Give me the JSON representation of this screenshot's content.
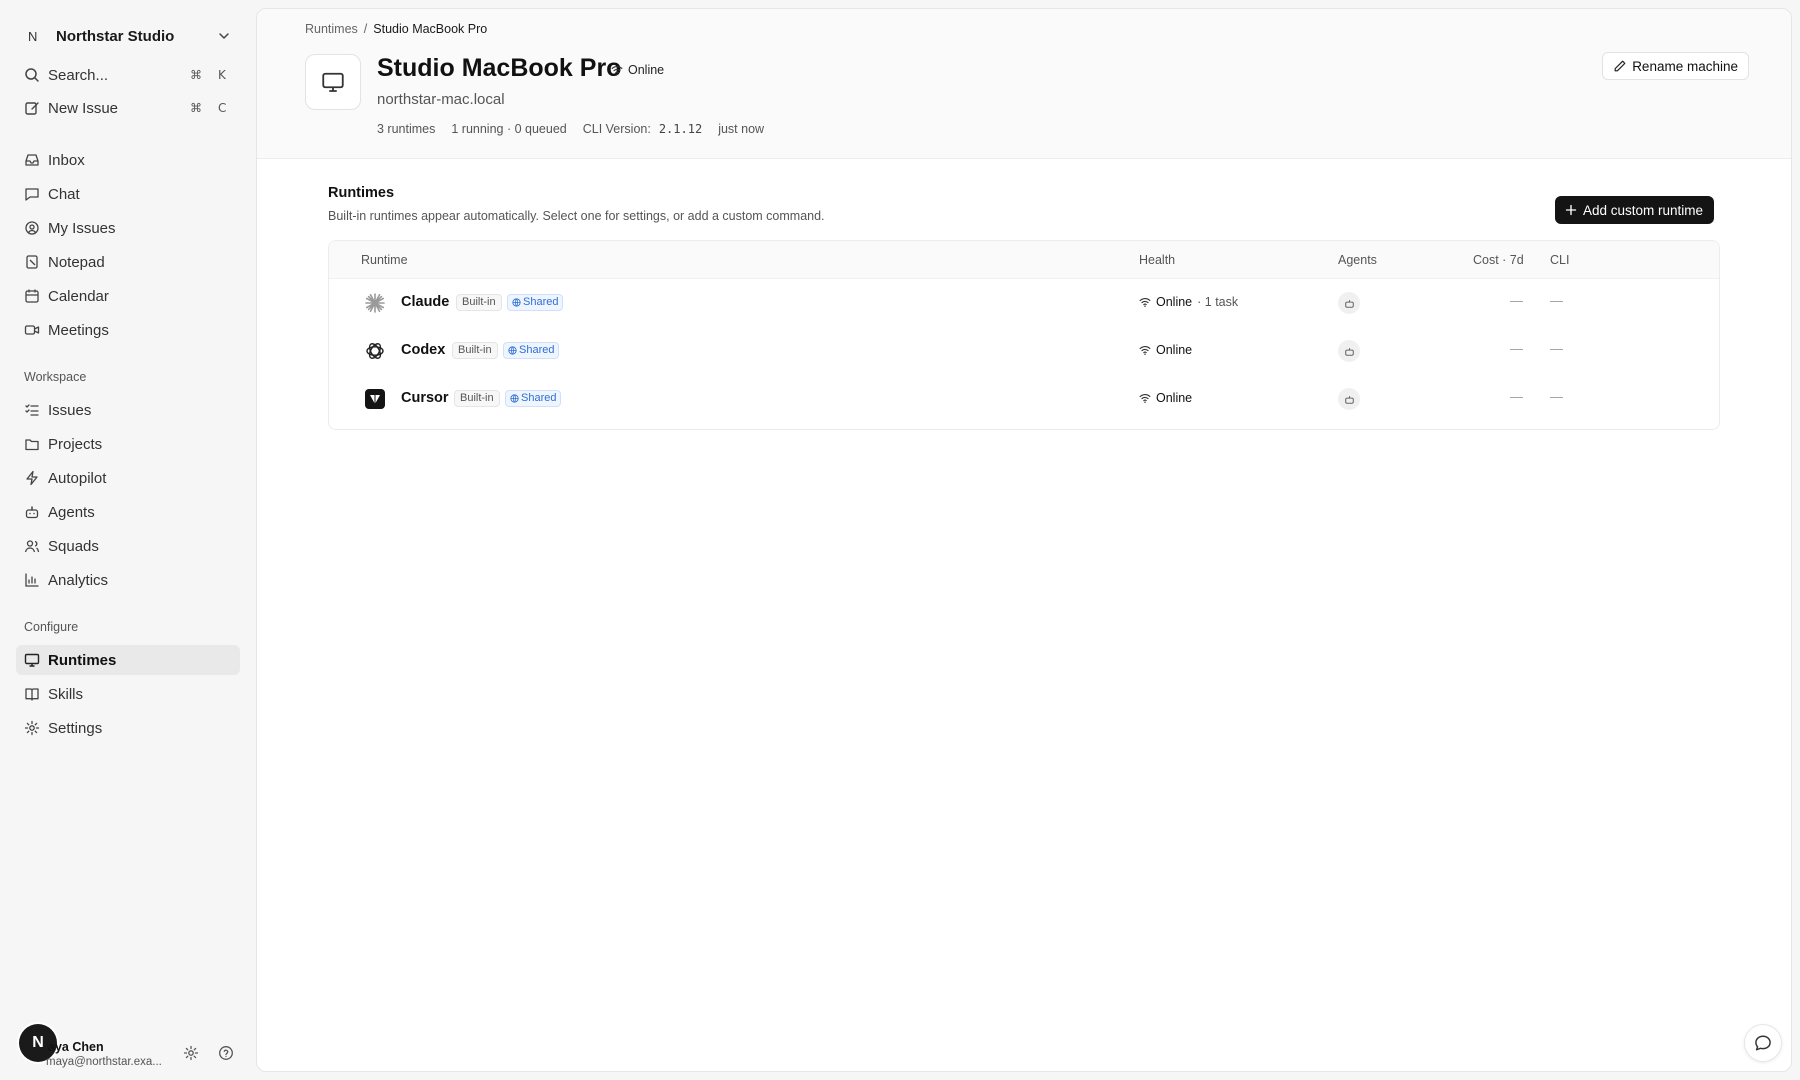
{
  "sidebar": {
    "workspace": {
      "logo_letter": "N",
      "name": "Northstar Studio"
    },
    "search": {
      "label": "Search...",
      "shortcut_mod": "⌘",
      "shortcut_key": "K"
    },
    "new_issue": {
      "label": "New Issue",
      "shortcut_mod": "⌘",
      "shortcut_key": "C"
    },
    "primary": [
      {
        "label": "Inbox",
        "icon": "inbox-icon"
      },
      {
        "label": "Chat",
        "icon": "chat-icon"
      },
      {
        "label": "My Issues",
        "icon": "user-circle-icon"
      },
      {
        "label": "Notepad",
        "icon": "notepad-icon"
      },
      {
        "label": "Calendar",
        "icon": "calendar-icon"
      },
      {
        "label": "Meetings",
        "icon": "video-icon"
      }
    ],
    "workspace_section": {
      "label": "Workspace",
      "items": [
        {
          "label": "Issues",
          "icon": "list-icon"
        },
        {
          "label": "Projects",
          "icon": "folder-icon"
        },
        {
          "label": "Autopilot",
          "icon": "bolt-icon"
        },
        {
          "label": "Agents",
          "icon": "robot-icon"
        },
        {
          "label": "Squads",
          "icon": "users-icon"
        },
        {
          "label": "Analytics",
          "icon": "bar-chart-icon"
        }
      ]
    },
    "configure_section": {
      "label": "Configure",
      "items": [
        {
          "label": "Runtimes",
          "icon": "monitor-icon",
          "active": true
        },
        {
          "label": "Skills",
          "icon": "book-icon"
        },
        {
          "label": "Settings",
          "icon": "gear-icon"
        }
      ]
    },
    "user": {
      "avatar_letter": "N",
      "name": "aya Chen",
      "email": "maya@northstar.exa..."
    }
  },
  "header": {
    "breadcrumb": {
      "parent": "Runtimes",
      "separator": "/",
      "current": "Studio MacBook Pro"
    },
    "title": "Studio MacBook Pro",
    "status": "Online",
    "hostname": "northstar-mac.local",
    "meta": {
      "runtimes": "3 runtimes",
      "running": "1 running · 0 queued",
      "cli_label": "CLI Version:",
      "cli_version": "2.1.12",
      "updated": "just now"
    },
    "rename_label": "Rename machine"
  },
  "runtimes_section": {
    "title": "Runtimes",
    "subtitle": "Built-in runtimes appear automatically. Select one for settings, or add a custom command.",
    "add_label": "Add custom runtime",
    "columns": [
      "Runtime",
      "Health",
      "Agents",
      "Cost · 7d",
      "CLI"
    ],
    "rows": [
      {
        "name": "Claude",
        "builtin": "Built-in",
        "shared": "Shared",
        "health": "Online",
        "health_extra": "· 1 task",
        "cost": "—",
        "cli": "—",
        "logo": "claude-logo-icon"
      },
      {
        "name": "Codex",
        "builtin": "Built-in",
        "shared": "Shared",
        "health": "Online",
        "health_extra": "",
        "cost": "—",
        "cli": "—",
        "logo": "openai-logo-icon"
      },
      {
        "name": "Cursor",
        "builtin": "Built-in",
        "shared": "Shared",
        "health": "Online",
        "health_extra": "",
        "cost": "—",
        "cli": "—",
        "logo": "cursor-logo-icon"
      }
    ]
  },
  "colors": {
    "accent_dark": "#141414",
    "shared_blue": "#2f6fd1",
    "claude_orange": "#d97757"
  }
}
